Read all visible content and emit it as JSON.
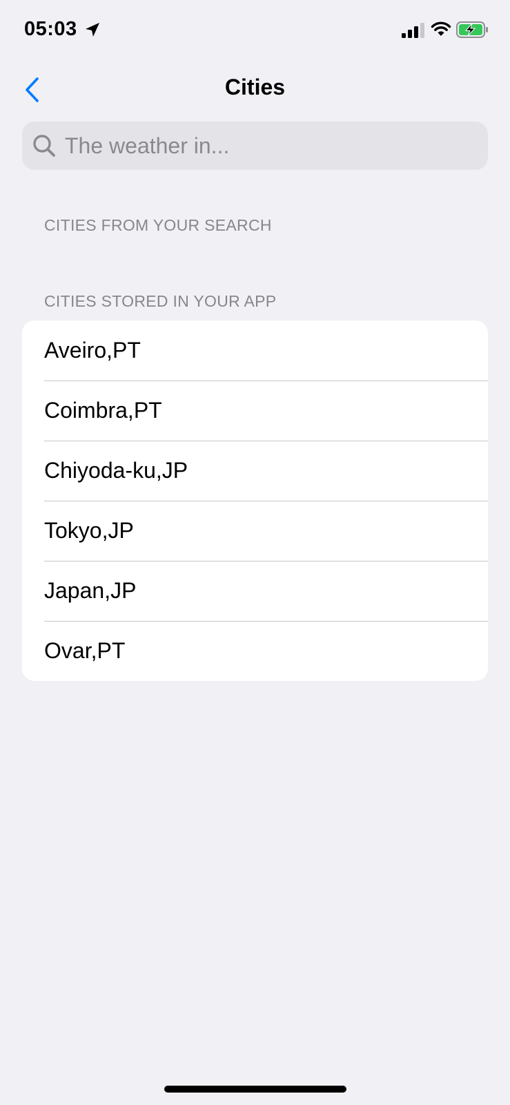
{
  "status_bar": {
    "time": "05:03",
    "icons": [
      "location-arrow-icon",
      "cellular-signal-icon",
      "wifi-icon",
      "battery-charging-icon"
    ],
    "battery_color": "#34c759"
  },
  "nav": {
    "title": "Cities",
    "back_icon": "chevron-left-icon",
    "accent_color": "#007aff"
  },
  "search": {
    "placeholder": "The weather in...",
    "value": "",
    "icon": "magnifying-glass-icon"
  },
  "sections": {
    "from_search": {
      "header": "CITIES FROM YOUR SEARCH",
      "items": []
    },
    "stored": {
      "header": "CITIES STORED IN YOUR APP",
      "items": [
        {
          "label": "Aveiro,PT"
        },
        {
          "label": "Coimbra,PT"
        },
        {
          "label": "Chiyoda-ku,JP"
        },
        {
          "label": "Tokyo,JP"
        },
        {
          "label": "Japan,JP"
        },
        {
          "label": "Ovar,PT"
        }
      ]
    }
  }
}
